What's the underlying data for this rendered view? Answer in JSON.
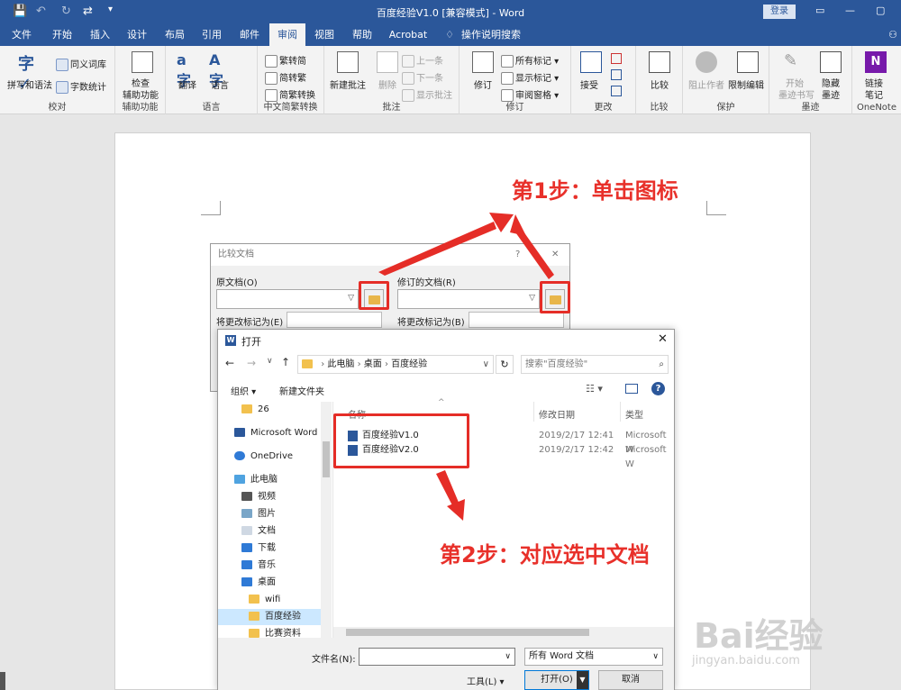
{
  "window": {
    "title": "百度经验V1.0 [兼容模式] - Word",
    "login_label": "登录",
    "quick_access": [
      "💾",
      "↶",
      "↻",
      "⇄",
      "▾"
    ]
  },
  "tabs": [
    {
      "label": "文件"
    },
    {
      "label": "开始"
    },
    {
      "label": "插入"
    },
    {
      "label": "设计"
    },
    {
      "label": "布局"
    },
    {
      "label": "引用"
    },
    {
      "label": "邮件"
    },
    {
      "label": "审阅"
    },
    {
      "label": "视图"
    },
    {
      "label": "帮助"
    },
    {
      "label": "Acrobat"
    },
    {
      "label": "操作说明搜索"
    }
  ],
  "ribbon": {
    "proofing": {
      "label": "校对",
      "spelling": "拼写和语法",
      "thesaurus": "同义词库",
      "wordcount": "字数统计"
    },
    "accessibility": {
      "label": "辅助功能",
      "check": "检查",
      "check2": "辅助功能"
    },
    "language": {
      "label": "语言",
      "translate": "翻译",
      "language": "语言"
    },
    "chinese": {
      "label": "中文简繁转换",
      "t2s": "繁转简",
      "s2t": "简转繁",
      "convert": "简繁转换"
    },
    "comments": {
      "label": "批注",
      "new": "新建批注",
      "delete": "删除",
      "prev": "上一条",
      "next": "下一条",
      "show": "显示批注"
    },
    "tracking": {
      "label": "修订",
      "track": "修订",
      "all_markup": "所有标记",
      "show_markup": "显示标记",
      "pane": "审阅窗格"
    },
    "changes": {
      "label": "更改",
      "accept": "接受"
    },
    "compare": {
      "label": "比较",
      "compare": "比较"
    },
    "protect": {
      "label": "保护",
      "block": "阻止作者",
      "restrict": "限制编辑"
    },
    "ink": {
      "label": "墨迹",
      "start": "开始",
      "start2": "墨迹书写",
      "hide": "隐藏",
      "hide2": "墨迹"
    },
    "onenote": {
      "label": "OneNote",
      "link": "链接",
      "link2": "笔记"
    }
  },
  "annotations": {
    "step1": "第1步：单击图标",
    "step2": "第2步：对应选中文档"
  },
  "compare_dialog": {
    "title": "比较文档",
    "help": "?",
    "original_label": "原文档(O)",
    "revised_label": "修订的文档(R)",
    "label_changes_left": "将更改标记为(E)",
    "label_changes_right": "将更改标记为(B)"
  },
  "open_dialog": {
    "title": "打开",
    "path": [
      "此电脑",
      "桌面",
      "百度经验"
    ],
    "search_placeholder": "搜索\"百度经验\"",
    "organize": "组织 ▾",
    "new_folder": "新建文件夹",
    "nav_items": [
      {
        "label": "26",
        "icon": "folder-icon"
      },
      {
        "label": "Microsoft Word",
        "icon": "word-icon"
      },
      {
        "label": "OneDrive",
        "icon": "cloud-icon"
      },
      {
        "label": "此电脑",
        "icon": "computer-icon"
      },
      {
        "label": "视频",
        "icon": "video-icon"
      },
      {
        "label": "图片",
        "icon": "picture-icon"
      },
      {
        "label": "文档",
        "icon": "document-icon"
      },
      {
        "label": "下载",
        "icon": "download-icon"
      },
      {
        "label": "音乐",
        "icon": "music-icon"
      },
      {
        "label": "桌面",
        "icon": "desktop-icon"
      },
      {
        "label": "wifi",
        "icon": "folder-icon"
      },
      {
        "label": "百度经验",
        "icon": "folder-icon"
      },
      {
        "label": "比赛资料",
        "icon": "folder-icon"
      }
    ],
    "columns": {
      "name": "名称",
      "date": "修改日期",
      "type": "类型"
    },
    "files": [
      {
        "name": "百度经验V1.0",
        "date": "2019/2/17 12:41",
        "type": "Microsoft W"
      },
      {
        "name": "百度经验V2.0",
        "date": "2019/2/17 12:42",
        "type": "Microsoft W"
      }
    ],
    "filename_label": "文件名(N):",
    "filename_value": "",
    "filetype": "所有 Word 文档",
    "tools": "工具(L)",
    "open": "打开(O)",
    "cancel": "取消"
  },
  "watermark": {
    "brand": "Bai经验",
    "url": "jingyan.baidu.com"
  },
  "colors": {
    "word_blue": "#2b579a",
    "annotation_red": "#e52d27"
  }
}
